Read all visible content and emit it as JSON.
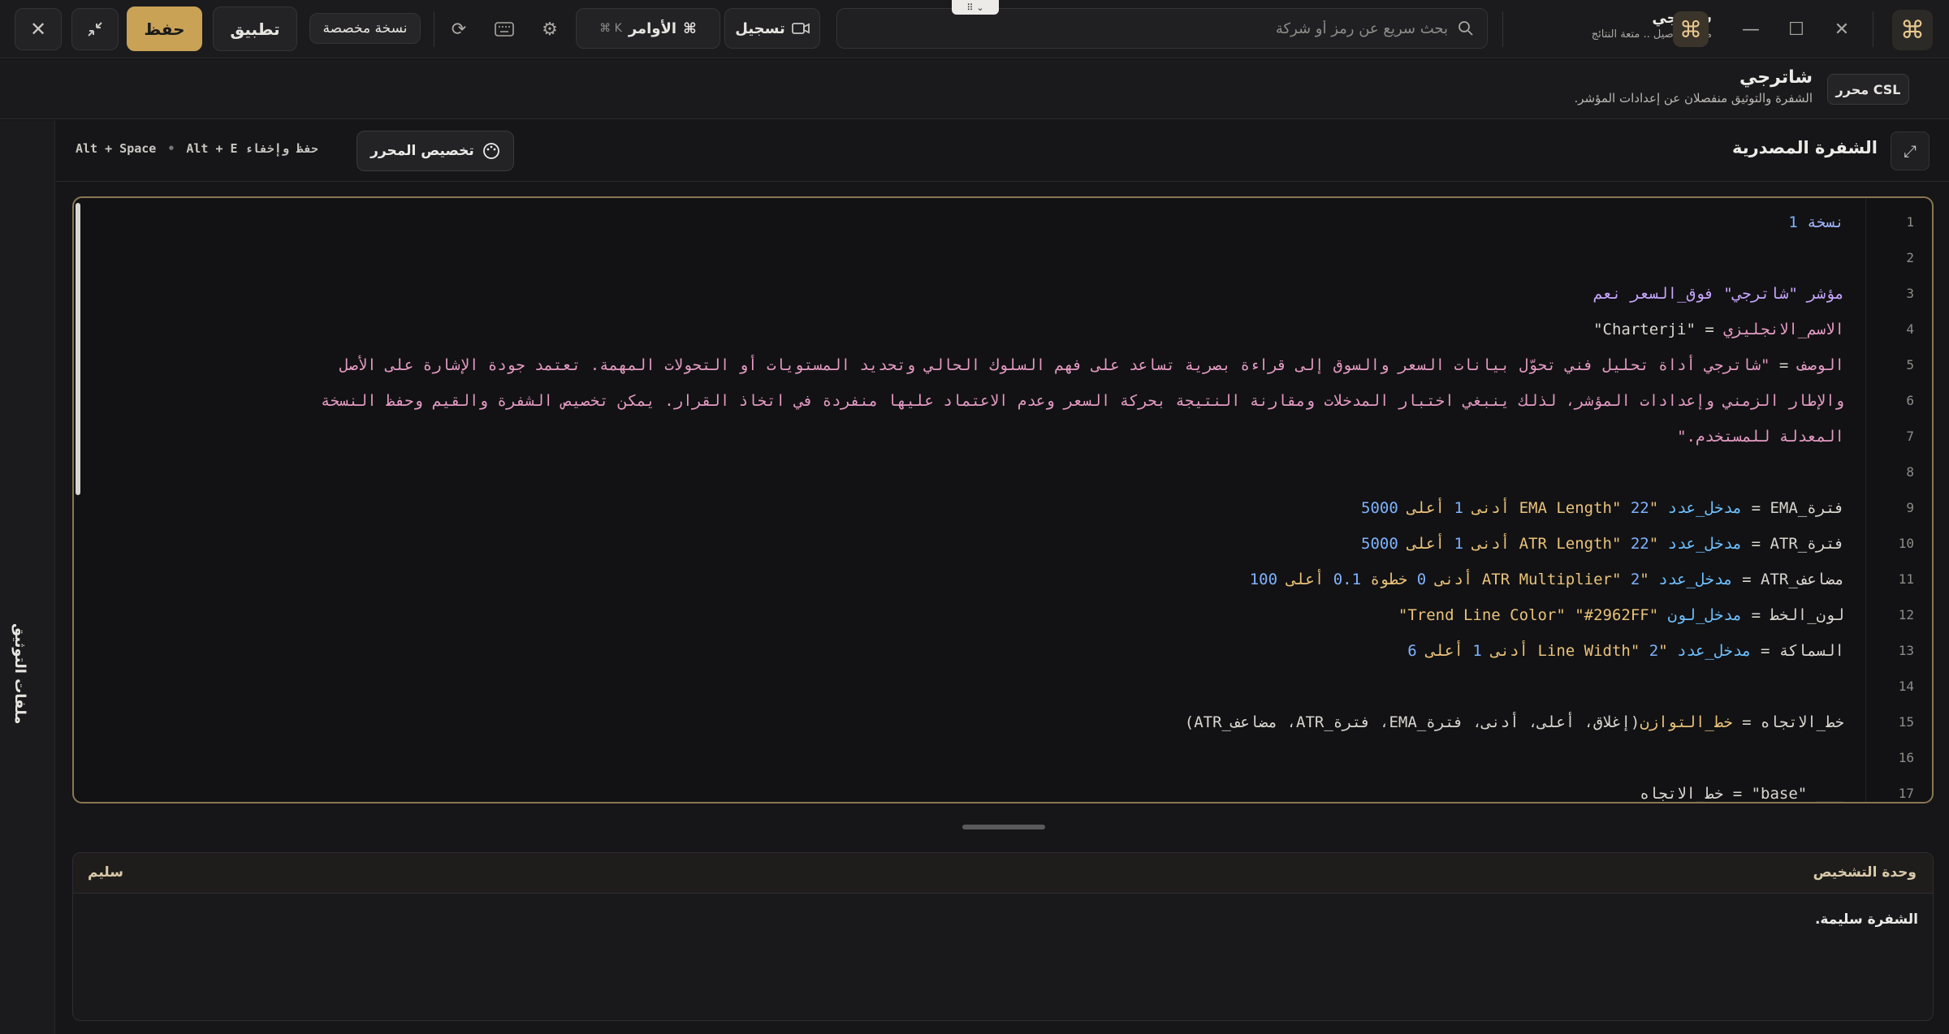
{
  "topbar": {
    "close_icon": "close-icon",
    "save_label": "حفظ",
    "apply_label": "تطبيق",
    "custom_copy_label": "نسخة مخصصة",
    "commands_label": "الأوامر",
    "commands_shortcut": "⌘ K",
    "record_label": "تسجيل",
    "search_placeholder": "بحث سريع عن رمز أو شركة",
    "brand_name": "شاترجي",
    "brand_tagline": "ملل التفاصيل .. متعة النتائج"
  },
  "header": {
    "editor_tag": "محرر CSL",
    "title": "شاترجي",
    "subtitle": "الشفرة والتوثيق منفصلان عن إعدادات المؤشر."
  },
  "rail": {
    "docs_tab": "ملفات التوثيق"
  },
  "source": {
    "title": "الشفرة المصدرية",
    "customize_label": "تخصيص المحرر",
    "hint_save": "Alt + E حفظ وإخفاء",
    "hint_space": "Alt + Space"
  },
  "code": {
    "lines": [
      {
        "n": "1",
        "tokens": [
          {
            "t": "نسخة ",
            "c": "kw"
          },
          {
            "t": "1",
            "c": "num"
          }
        ]
      },
      {
        "n": "2",
        "tokens": []
      },
      {
        "n": "3",
        "tokens": [
          {
            "t": "مؤشر ",
            "c": "id"
          },
          {
            "t": "\"شاترجي\" ",
            "c": "id"
          },
          {
            "t": "فوق_السعر ",
            "c": "id"
          },
          {
            "t": "نعم",
            "c": "id"
          }
        ]
      },
      {
        "n": "4",
        "tokens": [
          {
            "t": "الاسم_الانجليزي",
            "c": "desc"
          },
          {
            "t": " = ",
            "c": "pl"
          },
          {
            "t": "\"Charterji\"",
            "c": "pl"
          }
        ]
      },
      {
        "n": "5",
        "tokens": [
          {
            "t": "الوصف",
            "c": "desc"
          },
          {
            "t": " = ",
            "c": "pl"
          },
          {
            "t": "\"شاترجي أداة تحليل فني تحوّل بيانات السعر والسوق إلى قراءة بصرية تساعد على فهم السلوك الحالي وتحديد المستويات أو التحولات المهمة. تعتمد جودة الإشارة على الأصل",
            "c": "desc"
          }
        ]
      },
      {
        "n": "6",
        "tokens": [
          {
            "t": "والإطار الزمني وإعدادات المؤشر، لذلك ينبغي اختبار المدخلات ومقارنة النتيجة بحركة السعر وعدم الاعتماد عليها منفردة في اتخاذ القرار. يمكن تخصيص الشفرة والقيم وحفظ النسخة",
            "c": "desc"
          }
        ]
      },
      {
        "n": "7",
        "tokens": [
          {
            "t": "المعدلة للمستخدم.\"",
            "c": "desc"
          }
        ]
      },
      {
        "n": "8",
        "tokens": []
      },
      {
        "n": "9",
        "tokens": [
          {
            "t": "فترة_EMA",
            "c": "pl"
          },
          {
            "t": " = ",
            "c": "pl"
          },
          {
            "t": "مدخل_عدد ",
            "c": "fn"
          },
          {
            "t": "\"EMA Length\" ",
            "c": "str"
          },
          {
            "t": "22 ",
            "c": "num"
          },
          {
            "t": "أدنى ",
            "c": "str"
          },
          {
            "t": "1 ",
            "c": "num"
          },
          {
            "t": "أعلى ",
            "c": "str"
          },
          {
            "t": "5000",
            "c": "num"
          }
        ]
      },
      {
        "n": "10",
        "tokens": [
          {
            "t": "فترة_ATR",
            "c": "pl"
          },
          {
            "t": " = ",
            "c": "pl"
          },
          {
            "t": "مدخل_عدد ",
            "c": "fn"
          },
          {
            "t": "\"ATR Length\" ",
            "c": "str"
          },
          {
            "t": "22 ",
            "c": "num"
          },
          {
            "t": "أدنى ",
            "c": "str"
          },
          {
            "t": "1 ",
            "c": "num"
          },
          {
            "t": "أعلى ",
            "c": "str"
          },
          {
            "t": "5000",
            "c": "num"
          }
        ]
      },
      {
        "n": "11",
        "tokens": [
          {
            "t": "مضاعف_ATR",
            "c": "pl"
          },
          {
            "t": " = ",
            "c": "pl"
          },
          {
            "t": "مدخل_عدد ",
            "c": "fn"
          },
          {
            "t": "\"ATR Multiplier\" ",
            "c": "str"
          },
          {
            "t": "2 ",
            "c": "num"
          },
          {
            "t": "أدنى ",
            "c": "str"
          },
          {
            "t": "0 ",
            "c": "num"
          },
          {
            "t": "خطوة ",
            "c": "str"
          },
          {
            "t": "0.1 ",
            "c": "num"
          },
          {
            "t": "أعلى ",
            "c": "str"
          },
          {
            "t": "100",
            "c": "num"
          }
        ]
      },
      {
        "n": "12",
        "tokens": [
          {
            "t": "لون_الخط",
            "c": "pl"
          },
          {
            "t": " = ",
            "c": "pl"
          },
          {
            "t": "مدخل_لون ",
            "c": "fn"
          },
          {
            "t": "\"Trend Line Color\" ",
            "c": "str"
          },
          {
            "t": "\"#2962FF\"",
            "c": "str"
          }
        ]
      },
      {
        "n": "13",
        "tokens": [
          {
            "t": "السماكة",
            "c": "pl"
          },
          {
            "t": " = ",
            "c": "pl"
          },
          {
            "t": "مدخل_عدد ",
            "c": "fn"
          },
          {
            "t": "\"Line Width\" ",
            "c": "str"
          },
          {
            "t": "2 ",
            "c": "num"
          },
          {
            "t": "أدنى ",
            "c": "str"
          },
          {
            "t": "1 ",
            "c": "num"
          },
          {
            "t": "أعلى ",
            "c": "str"
          },
          {
            "t": "6",
            "c": "num"
          }
        ]
      },
      {
        "n": "14",
        "tokens": []
      },
      {
        "n": "15",
        "tokens": [
          {
            "t": "خط_الاتجاه",
            "c": "pl"
          },
          {
            "t": " = ",
            "c": "pl"
          },
          {
            "t": "خط_التوازن",
            "c": "str"
          },
          {
            "t": "(إغلاق، أعلى، أدنى، فترة_EMA، فترة_ATR، مضاعف_ATR)",
            "c": "pl"
          }
        ]
      },
      {
        "n": "16",
        "tokens": []
      },
      {
        "n": "17",
        "tokens": [
          {
            "t": "___ \"base\" = خط_الاتجاه",
            "c": "pl"
          }
        ]
      }
    ]
  },
  "diagnostics": {
    "title": "وحدة التشخيص",
    "status": "سليم",
    "message": "الشفرة سليمة."
  },
  "colors": {
    "accent": "#c9a256",
    "frame": "#8a7654"
  }
}
